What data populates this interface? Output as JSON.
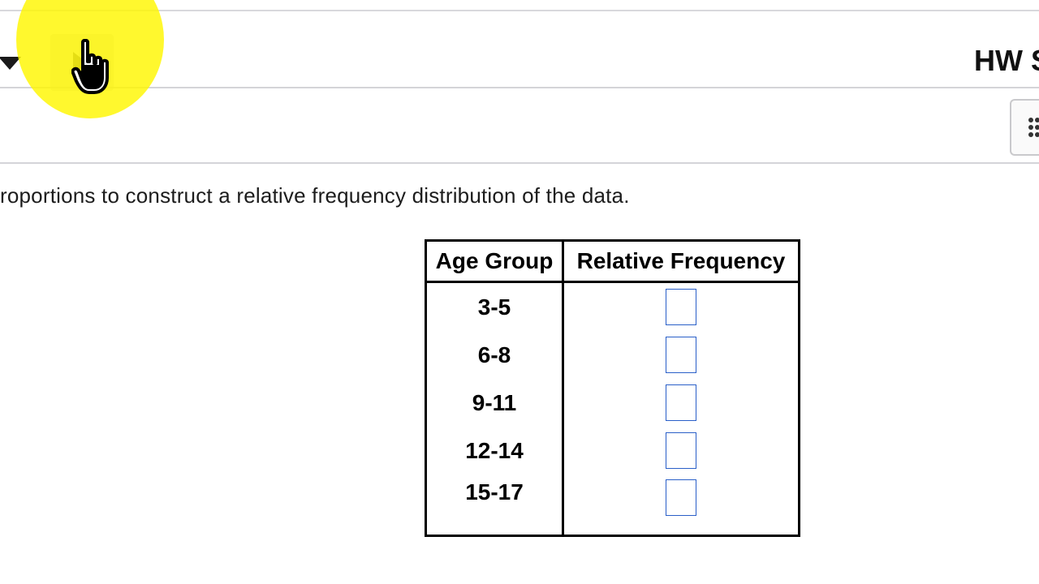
{
  "header": {
    "title": "HW S"
  },
  "instructions": "roportions to construct a relative frequency distribution of the data.",
  "table": {
    "headers": [
      "Age Group",
      "Relative Frequency"
    ],
    "rows": [
      {
        "age_group": "3-5",
        "relative_frequency": ""
      },
      {
        "age_group": "6-8",
        "relative_frequency": ""
      },
      {
        "age_group": "9-11",
        "relative_frequency": ""
      },
      {
        "age_group": "12-14",
        "relative_frequency": ""
      },
      {
        "age_group": "15-17",
        "relative_frequency": ""
      }
    ]
  },
  "icons": {
    "collapse": "triangle-down-icon",
    "next": "play-arrow-icon",
    "cursor": "hand-pointer-icon",
    "menu": "dots-grid-icon"
  },
  "colors": {
    "highlight": "#fff700",
    "input_border": "#2a5fc8"
  }
}
